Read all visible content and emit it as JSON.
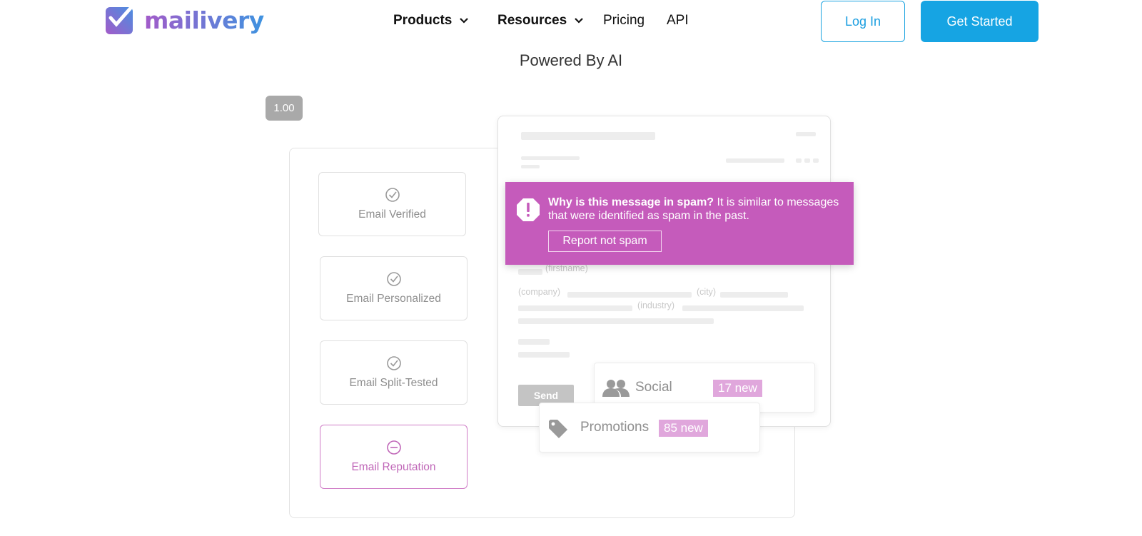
{
  "brand": {
    "name": "mailivery"
  },
  "nav": {
    "products": "Products",
    "resources": "Resources",
    "pricing": "Pricing",
    "api": "API"
  },
  "actions": {
    "login": "Log In",
    "get_started": "Get Started"
  },
  "section": {
    "subheading": "Powered By AI"
  },
  "zoom": "1.00",
  "checks": [
    {
      "label": "Email Verified",
      "icon": "check-circle-icon"
    },
    {
      "label": "Email Personalized",
      "icon": "check-circle-icon"
    },
    {
      "label": "Email Split-Tested",
      "icon": "check-circle-icon"
    },
    {
      "label": "Email Reputation",
      "icon": "minus-circle-icon"
    }
  ],
  "email_preview": {
    "placeholders": {
      "firstname": "(firstname)",
      "company": "(company)",
      "city": "(city)",
      "industry": "(industry)"
    },
    "send": "Send"
  },
  "spam_banner": {
    "question": "Why is this message in spam?",
    "explanation": " It is similar to messages that were identified as spam in the past.",
    "button": "Report not spam"
  },
  "categories": [
    {
      "label": "Social",
      "badge": "17 new",
      "icon": "people-icon"
    },
    {
      "label": "Promotions",
      "badge": "85 new",
      "icon": "tag-icon"
    }
  ],
  "colors": {
    "accent": "#16a4e3",
    "spam": "#c55bbb",
    "badge": "#e0a7dc"
  }
}
